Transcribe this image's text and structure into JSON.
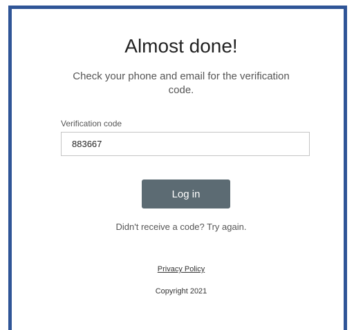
{
  "page": {
    "title": "Almost done!",
    "subtitle": "Check your phone and email for the verification code."
  },
  "form": {
    "code_label": "Verification code",
    "code_value": "883667",
    "login_label": "Log in"
  },
  "resend": {
    "text": "Didn't receive a code? Try again."
  },
  "footer": {
    "privacy_label": "Privacy Policy",
    "copyright": "Copyright 2021"
  },
  "colors": {
    "frame_border": "#2f5597",
    "button_bg": "#5c6b73"
  }
}
